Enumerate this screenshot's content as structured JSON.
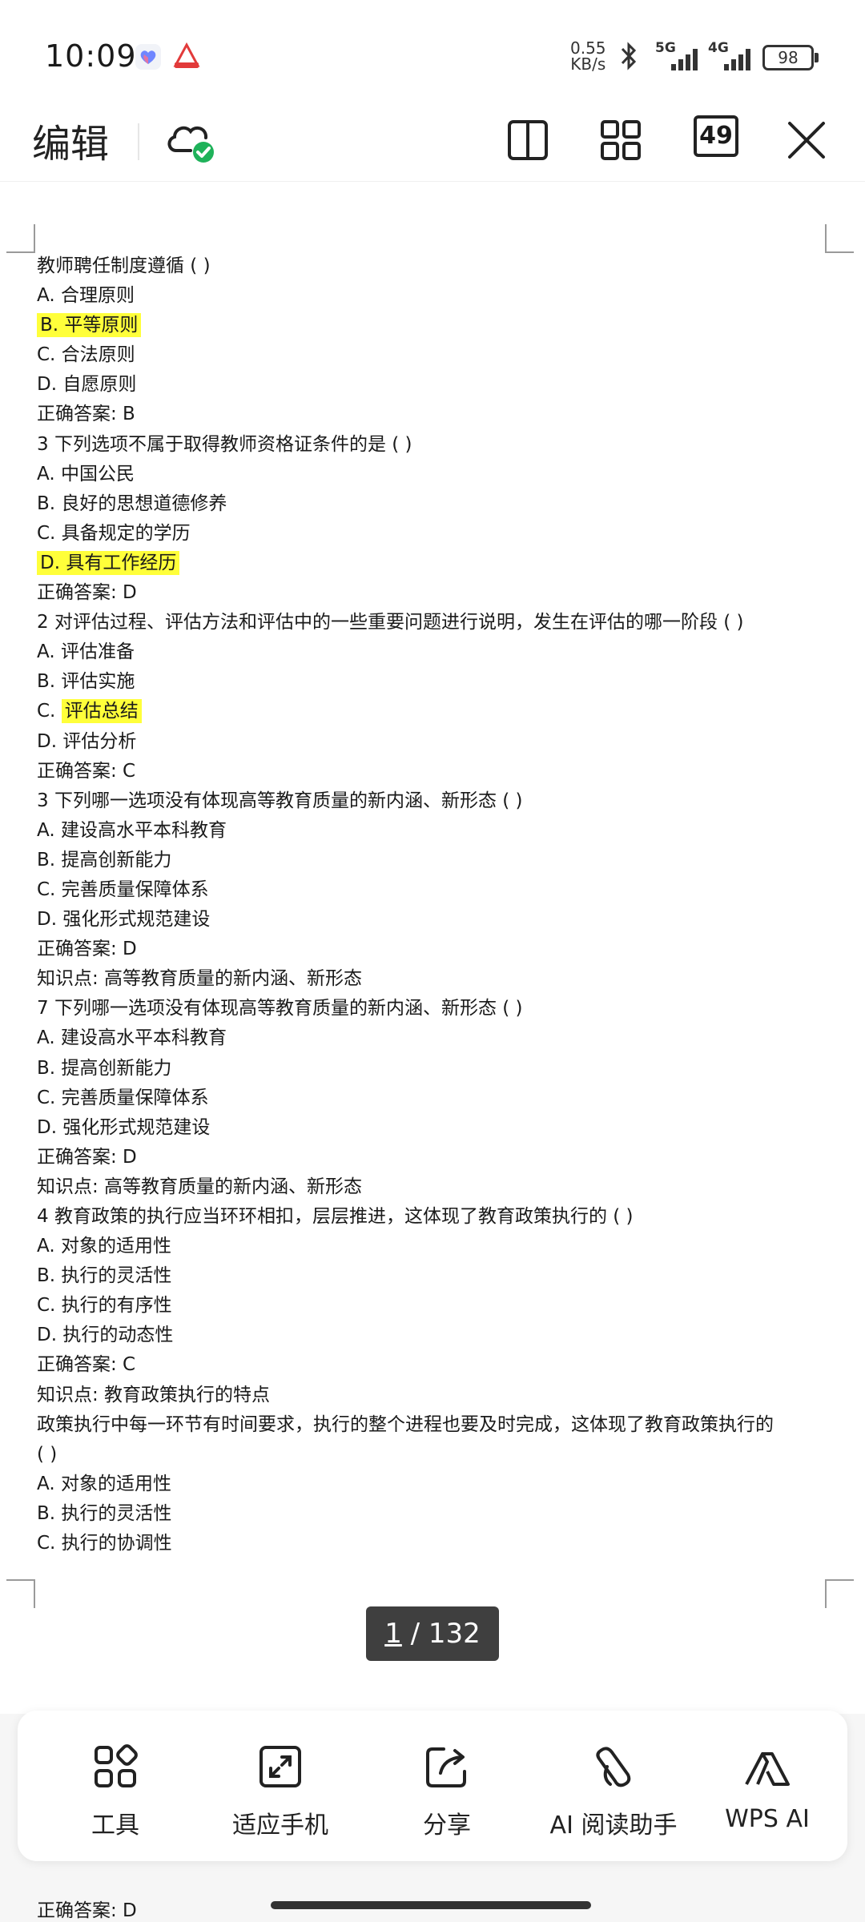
{
  "status": {
    "time": "10:09",
    "net_speed_top": "0.55",
    "net_speed_bottom": "KB/s",
    "sig1_label": "5G",
    "sig2_label": "4G",
    "battery": "98"
  },
  "toolbar": {
    "edit_label": "编辑",
    "page_count_badge": "49",
    "icons": [
      "cloud-synced-icon",
      "split-view-icon",
      "grid-view-icon",
      "page-count-icon",
      "close-icon"
    ]
  },
  "document": {
    "lines": [
      {
        "text": "教师聘任制度遵循 ( )"
      },
      {
        "text": "A.  合理原则"
      },
      {
        "prefix": "B.  平等原则",
        "highlight": true
      },
      {
        "text": "C.  合法原则"
      },
      {
        "text": "D.  自愿原则"
      },
      {
        "text": "正确答案: B"
      },
      {
        "text": "3 下列选项不属于取得教师资格证条件的是 ( )"
      },
      {
        "text": "A.  中国公民"
      },
      {
        "text": "B.  良好的思想道德修养"
      },
      {
        "text": "C.  具备规定的学历"
      },
      {
        "prefix": "D.  具有工作经历",
        "highlight": true
      },
      {
        "text": "正确答案: D"
      },
      {
        "text": "2 对评估过程、评估方法和评估中的一些重要问题进行说明，发生在评估的哪一阶段 ( )"
      },
      {
        "text": "A.  评估准备"
      },
      {
        "text": "B.  评估实施"
      },
      {
        "text": "C.  评估总结",
        "hl_part": "评估总结"
      },
      {
        "text": "D.  评估分析"
      },
      {
        "text": "正确答案: C"
      },
      {
        "text": "3 下列哪一选项没有体现高等教育质量的新内涵、新形态 ( )"
      },
      {
        "text": "A.  建设高水平本科教育"
      },
      {
        "text": "B.  提高创新能力"
      },
      {
        "text": "C.  完善质量保障体系"
      },
      {
        "text": "D.  强化形式规范建设"
      },
      {
        "text": "正确答案: D"
      },
      {
        "text": "知识点:  高等教育质量的新内涵、新形态"
      },
      {
        "text": "7 下列哪一选项没有体现高等教育质量的新内涵、新形态 ( )"
      },
      {
        "text": "A.  建设高水平本科教育"
      },
      {
        "text": "B.  提高创新能力"
      },
      {
        "text": "C.  完善质量保障体系"
      },
      {
        "text": "D.  强化形式规范建设"
      },
      {
        "text": "正确答案: D"
      },
      {
        "text": "知识点:  高等教育质量的新内涵、新形态"
      },
      {
        "text": "4 教育政策的执行应当环环相扣，层层推进，这体现了教育政策执行的 ( )"
      },
      {
        "text": "A.  对象的适用性"
      },
      {
        "text": "B.  执行的灵活性"
      },
      {
        "text": "C.  执行的有序性"
      },
      {
        "text": "D.  执行的动态性"
      },
      {
        "text": "正确答案: C"
      },
      {
        "text": "知识点:  教育政策执行的特点"
      },
      {
        "text": "政策执行中每一环节有时间要求，执行的整个进程也要及时完成，这体现了教育政策执行的"
      },
      {
        "text": "( )"
      },
      {
        "text": "A.  对象的适用性"
      },
      {
        "text": "B.  执行的灵活性"
      },
      {
        "text": "C.  执行的协调性"
      }
    ],
    "page_current": "1",
    "page_sep_total": " / 132"
  },
  "bottom_bar": {
    "items": [
      {
        "label": "工具",
        "icon": "tools-grid-icon"
      },
      {
        "label": "适应手机",
        "icon": "fit-screen-icon"
      },
      {
        "label": "分享",
        "icon": "share-icon"
      },
      {
        "label": "AI 阅读助手",
        "icon": "ai-reader-icon"
      },
      {
        "label": "WPS AI",
        "icon": "wps-ai-icon"
      }
    ]
  },
  "peek_line": "正确答案: D"
}
